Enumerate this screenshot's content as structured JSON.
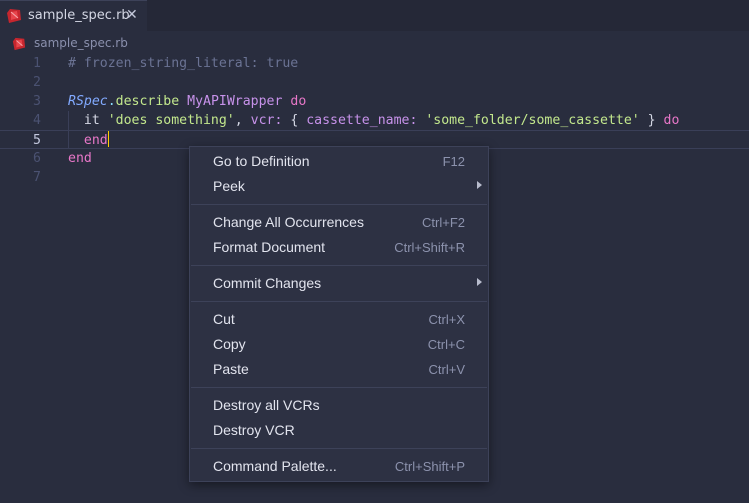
{
  "tab": {
    "label": "sample_spec.rb",
    "close_glyph": "✕"
  },
  "breadcrumb": {
    "label": "sample_spec.rb"
  },
  "editor": {
    "line_numbers": [
      "1",
      "2",
      "3",
      "4",
      "5",
      "6",
      "7"
    ],
    "active_line": 5,
    "lines": [
      [
        {
          "t": "# frozen_string_literal: true",
          "k": "comment"
        }
      ],
      [],
      [
        {
          "t": "RSpec",
          "k": "const"
        },
        {
          "t": ".",
          "k": "dot"
        },
        {
          "t": "describe",
          "k": "method"
        },
        {
          "t": " ",
          "k": "plain"
        },
        {
          "t": "MyAPIWrapper",
          "k": "class"
        },
        {
          "t": " ",
          "k": "plain"
        },
        {
          "t": "do",
          "k": "kw"
        }
      ],
      [
        {
          "t": "  it ",
          "k": "plain"
        },
        {
          "t": "'does something'",
          "k": "str"
        },
        {
          "t": ", ",
          "k": "plain"
        },
        {
          "t": "vcr:",
          "k": "sym"
        },
        {
          "t": " { ",
          "k": "plain"
        },
        {
          "t": "cassette_name:",
          "k": "sym"
        },
        {
          "t": " ",
          "k": "plain"
        },
        {
          "t": "'some_folder/some_cassette'",
          "k": "str"
        },
        {
          "t": " } ",
          "k": "plain"
        },
        {
          "t": "do",
          "k": "kw"
        }
      ],
      [
        {
          "t": "  ",
          "k": "plain"
        },
        {
          "t": "end",
          "k": "kw"
        }
      ],
      [
        {
          "t": "end",
          "k": "kw"
        }
      ],
      []
    ]
  },
  "context_menu": {
    "groups": [
      [
        {
          "label": "Go to Definition",
          "shortcut": "F12"
        },
        {
          "label": "Peek",
          "shortcut": "",
          "submenu": true
        }
      ],
      [
        {
          "label": "Change All Occurrences",
          "shortcut": "Ctrl+F2"
        },
        {
          "label": "Format Document",
          "shortcut": "Ctrl+Shift+R"
        }
      ],
      [
        {
          "label": "Commit Changes",
          "shortcut": "",
          "submenu": true
        }
      ],
      [
        {
          "label": "Cut",
          "shortcut": "Ctrl+X"
        },
        {
          "label": "Copy",
          "shortcut": "Ctrl+C"
        },
        {
          "label": "Paste",
          "shortcut": "Ctrl+V"
        }
      ],
      [
        {
          "label": "Destroy all VCRs",
          "shortcut": ""
        },
        {
          "label": "Destroy VCR",
          "shortcut": ""
        }
      ],
      [
        {
          "label": "Command Palette...",
          "shortcut": "Ctrl+Shift+P"
        }
      ]
    ]
  },
  "colors": {
    "background": "#292d3e",
    "ruby_icon": "#c6262e",
    "caret": "#ffcc00"
  }
}
